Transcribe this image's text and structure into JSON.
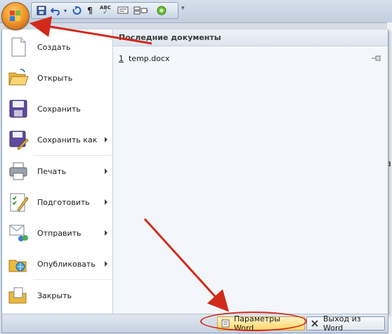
{
  "qat": {
    "icons": [
      "save-icon",
      "undo-icon",
      "dropdown-arrow-icon",
      "redo-icon",
      "pilcrow-icon",
      "spellcheck-icon",
      "format-icon",
      "layout-icon",
      "green-circle-icon",
      "customize-dropdown-icon"
    ],
    "pilcrow": "¶",
    "spell": "ABC"
  },
  "menu": {
    "commands": [
      {
        "label": "Создать",
        "icon": "new-document-icon",
        "submenu": false
      },
      {
        "label": "Открыть",
        "icon": "open-folder-icon",
        "submenu": false
      },
      {
        "label": "Сохранить",
        "icon": "save-disk-icon",
        "submenu": false
      },
      {
        "label": "Сохранить как",
        "icon": "save-as-icon",
        "submenu": true
      },
      {
        "label": "Печать",
        "icon": "printer-icon",
        "submenu": true
      },
      {
        "label": "Подготовить",
        "icon": "prepare-icon",
        "submenu": true
      },
      {
        "label": "Отправить",
        "icon": "send-icon",
        "submenu": true
      },
      {
        "label": "Опубликовать",
        "icon": "publish-icon",
        "submenu": true
      },
      {
        "label": "Закрыть",
        "icon": "close-folder-icon",
        "submenu": false
      }
    ],
    "recent_header": "Последние документы",
    "recent": [
      {
        "num": "1",
        "name": "temp.docx"
      }
    ]
  },
  "bottom": {
    "params_label": "Параметры Word",
    "exit_label": "Выход из Word"
  },
  "annotations": {
    "arrow_color": "#d22a1a"
  },
  "edge_text": "а"
}
